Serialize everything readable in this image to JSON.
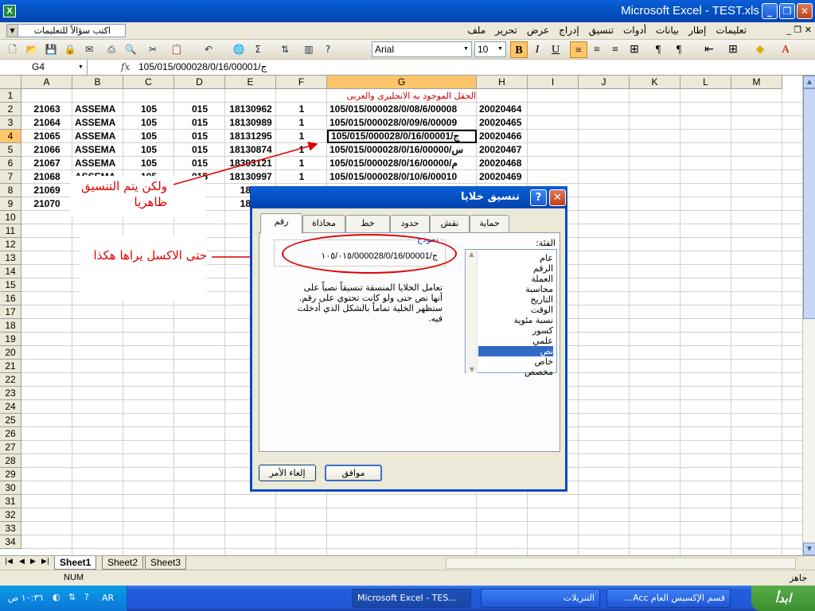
{
  "window": {
    "title": "Microsoft Excel - TEST.xls",
    "app_icon": "X",
    "min": "_",
    "max": "❐",
    "close": "✕"
  },
  "menubar": {
    "ask_placeholder": "اكتب سؤالاً للتعليمات",
    "items": [
      "ملف",
      "تحرير",
      "عرض",
      "إدراج",
      "تنسيق",
      "أدوات",
      "بيانات",
      "إطار",
      "تعليمات"
    ],
    "doc_controls": "_ ❐ ✕"
  },
  "toolbar": {
    "font": "Arial",
    "size": "10",
    "bold": "B",
    "italic": "I",
    "underline": "U",
    "sum": "Σ"
  },
  "formula_bar": {
    "name_box": "G4",
    "fx": "fx",
    "content": "105/015/000028/0/1ج/6/00001"
  },
  "columns": [
    "A",
    "B",
    "C",
    "D",
    "E",
    "F",
    "G",
    "H",
    "I",
    "J",
    "K",
    "L",
    "M"
  ],
  "rows": [
    "1",
    "2",
    "3",
    "4",
    "5",
    "6",
    "7",
    "8",
    "9",
    "10",
    "11",
    "12",
    "13",
    "14",
    "15",
    "16",
    "17",
    "18",
    "19",
    "20",
    "21",
    "22",
    "23",
    "24",
    "25",
    "26",
    "27",
    "28",
    "29",
    "30",
    "31",
    "32",
    "33",
    "34"
  ],
  "header_note": "الحقل الموجود به الانجليزى والعربى",
  "table": [
    [
      "21063",
      "ASSEMA",
      "105",
      "015",
      "18130962",
      "1",
      "105/015/000028/0/08/6/00008",
      "20020464"
    ],
    [
      "21064",
      "ASSEMA",
      "105",
      "015",
      "18130989",
      "1",
      "105/015/000028/0/09/6/00009",
      "20020465"
    ],
    [
      "21065",
      "ASSEMA",
      "105",
      "015",
      "18131295",
      "1",
      "105/015/000028/0/1ج/6/00001",
      "20020466"
    ],
    [
      "21066",
      "ASSEMA",
      "105",
      "015",
      "18130874",
      "1",
      "105/015/000028/0/1س/6/00000",
      "20020467"
    ],
    [
      "21067",
      "ASSEMA",
      "105",
      "015",
      "18393121",
      "1",
      "105/015/000028/0/1م/6/00000",
      "20020468"
    ],
    [
      "21068",
      "ASSEMA",
      "105",
      "015",
      "18130997",
      "1",
      "105/015/000028/0/10/6/00010",
      "20020469"
    ],
    [
      "21069",
      "",
      "",
      "5",
      "1813",
      "",
      "",
      ""
    ],
    [
      "21070",
      "",
      "",
      "5",
      "1813",
      "",
      "",
      ""
    ]
  ],
  "annotations": {
    "note1_line1": "ولكن يتم التنسيق",
    "note1_line2": "ظاهريا",
    "note2": "حتى الاكسل يراها هكذا"
  },
  "dialog": {
    "title": "تنسيق خلايا",
    "help": "?",
    "close": "✕",
    "tabs": [
      "حماية",
      "نقش",
      "حدود",
      "خط",
      "محاذاة",
      "رقم"
    ],
    "category_label": "الفئة:",
    "categories": [
      "عام",
      "الرقم",
      "العملة",
      "محاسبة",
      "التاريخ",
      "الوقت",
      "نسبة مئوية",
      "كسور",
      "علمي",
      "نص",
      "خاص",
      "مخصص"
    ],
    "selected_category": "نص",
    "sample_label": "نموذج",
    "sample_value": "١٠٥/٠١٥/000028/0/1ج/6/00001",
    "description": "تعامل الخلايا المنسقة تنسيقاً نصياً على أنها نص حتى ولو كانت تحتوي على رقم. ستظهر الخلية تماماً بالشكل الذي أدخلت فيه.",
    "ok": "موافق",
    "cancel": "إلغاء الأمر"
  },
  "sheets": [
    "Sheet1",
    "Sheet2",
    "Sheet3"
  ],
  "status": {
    "ready": "جاهز",
    "num": "NUM"
  },
  "taskbar": {
    "start": "ابدأ",
    "tasks": [
      "قسم الإكسيس العام Acc...",
      "التنزيلات",
      "Microsoft Excel - TES..."
    ],
    "lang": "AR",
    "clock": "١٠:٣٦ ص"
  }
}
